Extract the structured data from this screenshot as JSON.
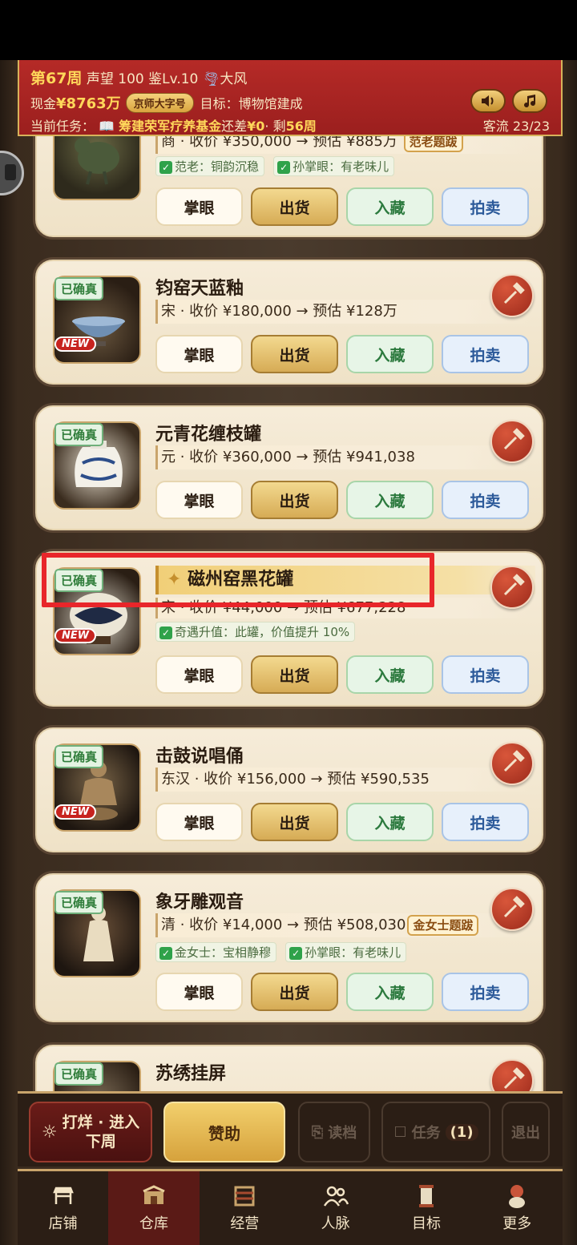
{
  "header": {
    "week": "第67周",
    "reputation_label": "声望 100",
    "appraisal_level": "鉴Lv.10",
    "weather": "大风",
    "cash_label": "现金",
    "cash_value": "¥8763万",
    "title_pill": "京师大字号",
    "goal": "目标：博物馆建成",
    "task_label": "当前任务：",
    "task_name": "筹建荣军疗养基金",
    "task_remaining_prefix": "还差",
    "task_remaining_value": "¥0",
    "task_weeks_prefix": "· 剩",
    "task_weeks_value": "56周",
    "visitors": "客流 23/23"
  },
  "card_actions": {
    "appraise": "掌眼",
    "ship": "出货",
    "collect": "入藏",
    "auction": "拍卖"
  },
  "items": [
    {
      "title": "",
      "info": "商 · 收价 ¥350,000 → 预估 ¥885万",
      "tag": "范老题跋",
      "traits": [
        "范老：铜韵沉稳",
        "孙掌眼：有老味儿"
      ]
    },
    {
      "badge": "已确真",
      "new": "NEW",
      "title": "钧窑天蓝釉",
      "info": "宋 · 收价 ¥180,000 → 预估 ¥128万"
    },
    {
      "badge": "已确真",
      "title": "元青花缠枝罐",
      "info": "元 · 收价 ¥360,000 → 预估 ¥941,038"
    },
    {
      "badge": "已确真",
      "new": "NEW",
      "title": "磁州窑黑花罐",
      "info": "宋 · 收价 ¥44,000 → 预估 ¥677,228",
      "traits": [
        "奇遇升值：此罐，价值提升 10%"
      ]
    },
    {
      "badge": "已确真",
      "new": "NEW",
      "title": "击鼓说唱俑",
      "info": "东汉 · 收价 ¥156,000 → 预估 ¥590,535"
    },
    {
      "badge": "已确真",
      "title": "象牙雕观音",
      "info": "清 · 收价 ¥14,000 → 预估 ¥508,030",
      "tag": "金女士题跋",
      "traits": [
        "金女士：宝相静穆",
        "孙掌眼：有老味儿"
      ]
    },
    {
      "badge": "已确真",
      "title": "苏绣挂屏"
    }
  ],
  "bottom_bar": {
    "next_week": "打烊 · 进入下周",
    "next_week_line1": "打烊 · 进入",
    "next_week_line2": "下周",
    "sponsor": "赞助",
    "load": "读档",
    "task": "任务",
    "task_count": "(1)",
    "exit": "退出"
  },
  "nav": [
    "店铺",
    "仓库",
    "经营",
    "人脉",
    "目标",
    "更多"
  ],
  "nav_active": "仓库",
  "colors": {
    "header_red": "#b52a27",
    "gold": "#ffd75a",
    "highlight_red": "#e8262a"
  }
}
